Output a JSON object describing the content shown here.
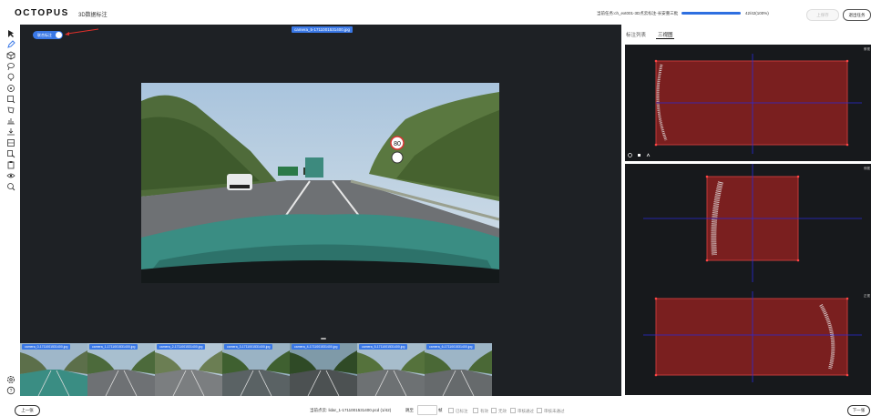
{
  "header": {
    "logo": "OCTOPUS",
    "subtitle": "3D数据标注",
    "task": "当前任务:ch_ext001-3D点云标注-长安重三批",
    "progress_text": "42/42(100%)",
    "progress_fraction": 1.0,
    "save_label": "上保存",
    "exit_label": "退出任务"
  },
  "toolbar": {
    "tools": [
      "cursor-icon",
      "pen-icon",
      "cube-icon",
      "lasso-icon",
      "point-icon",
      "target-icon",
      "box-select-icon",
      "polygon-icon",
      "split-icon",
      "merge-icon",
      "table-icon",
      "copy-icon",
      "paste-icon",
      "eye-icon",
      "zoom-icon"
    ],
    "bottom_tools": [
      "settings-icon",
      "help-icon"
    ]
  },
  "main": {
    "top_camera_label": "camera_5-1711001531400.jpg",
    "fusion_toggle_label": "联合标注",
    "thumbnails": [
      {
        "label": "camera_0-1711001531400.jpg"
      },
      {
        "label": "camera_1-1711001531400.jpg"
      },
      {
        "label": "camera_2-1711001531400.jpg"
      },
      {
        "label": "camera_3-1711001531400.jpg"
      },
      {
        "label": "camera_4-1711001531400.jpg"
      },
      {
        "label": "camera_5-1711001531400.jpg"
      },
      {
        "label": "camera_6-1711001531400.jpg"
      }
    ],
    "speed_sign": "80"
  },
  "right_panel": {
    "tabs": [
      {
        "label": "标注列表"
      },
      {
        "label": "三视图"
      }
    ],
    "active_tab": 1,
    "views": [
      {
        "label": "俯视"
      },
      {
        "label": "侧视"
      },
      {
        "label": "正视"
      }
    ]
  },
  "footer": {
    "prev_label": "上一张",
    "next_label": "下一张",
    "frame_info": "当前点云: lidar_1-1711001531400.pcd (1/42)",
    "jump_label": "跳至",
    "jump_unit": "帧",
    "filters": [
      "已标注",
      "有效",
      "无效",
      "审核通过",
      "审核未通过"
    ]
  },
  "colors": {
    "accent": "#3a78e6",
    "box_fill": "#7a1f1f",
    "canvas_bg": "#1e2125"
  }
}
